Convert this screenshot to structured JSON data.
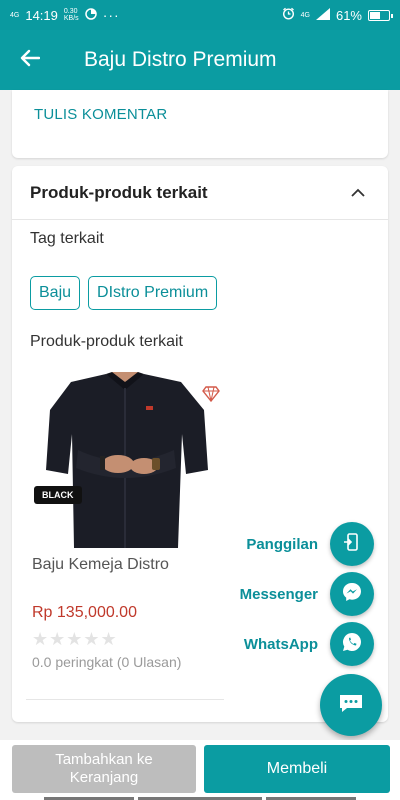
{
  "status_bar": {
    "network_left": "4G",
    "time": "14:19",
    "speed_value": "0.30",
    "speed_unit": "KB/s",
    "dots": "···",
    "network_right": "4G",
    "battery_text": "61%",
    "battery_level": 0.61
  },
  "app_bar": {
    "title": "Baju Distro Premium"
  },
  "comment_card": {
    "link_label": "TULIS KOMENTAR"
  },
  "related_card": {
    "header_title": "Produk-produk terkait",
    "tags_label": "Tag terkait",
    "tags": [
      "Baju",
      "DIstro Premium"
    ],
    "products_label": "Produk-produk terkait",
    "product": {
      "image_badge": "BLACK",
      "name": "Baju Kemeja Distro",
      "price": "Rp 135,000.00",
      "stars": "★★★★★",
      "rating_text": "0.0 peringkat (0 Ulasan)"
    }
  },
  "contact_menu": {
    "call_label": "Panggilan",
    "messenger_label": "Messenger",
    "whatsapp_label": "WhatsApp"
  },
  "bottom_bar": {
    "add_to_cart": "Tambahkan ke Keranjang",
    "buy": "Membeli"
  },
  "colors": {
    "primary": "#0b9ca2",
    "link": "#0b8f99",
    "price": "#c0392b",
    "disabled_button": "#bdbdbd"
  }
}
